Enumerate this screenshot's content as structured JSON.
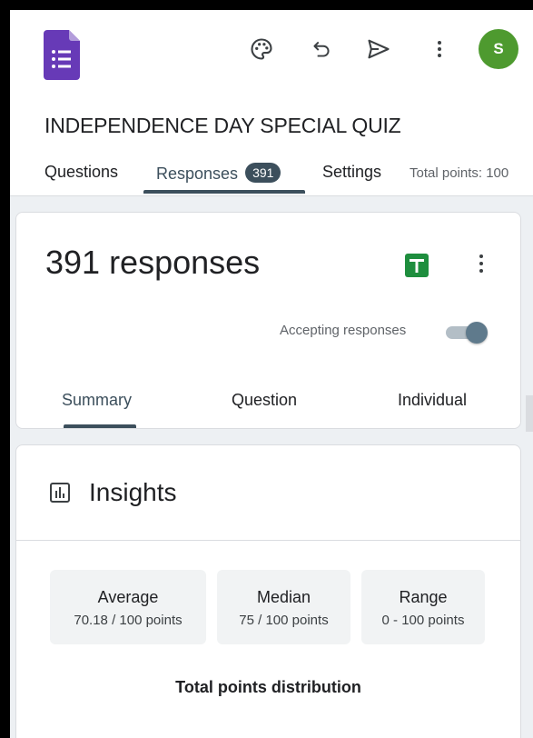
{
  "header": {
    "form_title": "INDEPENDENCE DAY SPECIAL QUIZ",
    "avatar_letter": "S",
    "avatar_color": "#4e9a2f",
    "brand_color": "#673ab7",
    "icons": [
      "palette-icon",
      "undo-icon",
      "send-icon",
      "more-vert-icon"
    ]
  },
  "tabs": {
    "questions": "Questions",
    "responses": "Responses",
    "responses_count": "391",
    "settings": "Settings",
    "total_points": "Total points: 100"
  },
  "responses_card": {
    "title": "391 responses",
    "accepting_label": "Accepting responses",
    "accepting": true,
    "subtabs": {
      "summary": "Summary",
      "question": "Question",
      "individual": "Individual"
    }
  },
  "insights": {
    "title": "Insights",
    "stats": [
      {
        "label": "Average",
        "value": "70.18 / 100 points"
      },
      {
        "label": "Median",
        "value": "75 / 100 points"
      },
      {
        "label": "Range",
        "value": "0 - 100 points"
      }
    ],
    "distribution_title": "Total points distribution"
  }
}
